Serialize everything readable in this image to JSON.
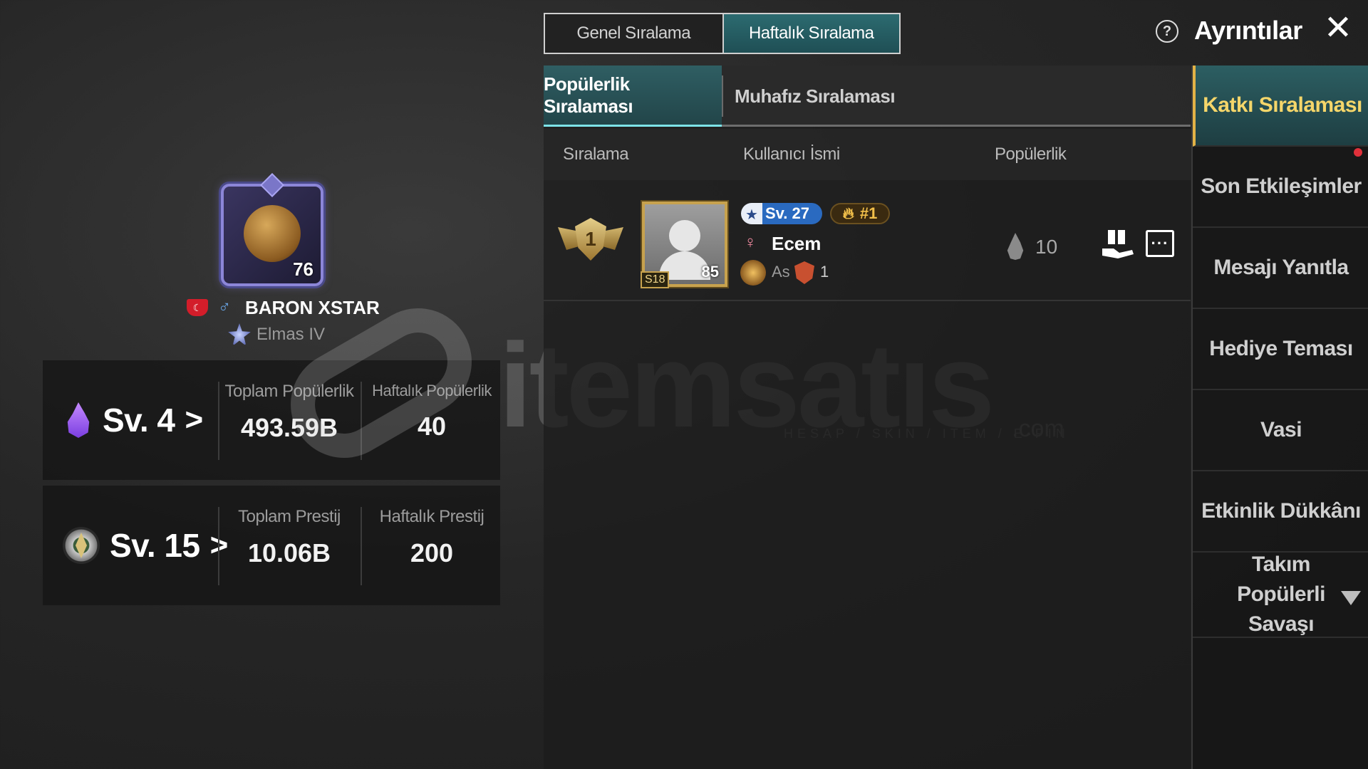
{
  "player": {
    "avatar_level": "76",
    "name": "BARON  XSTAR",
    "tier": "Elmas IV",
    "flag_icon": "turkey-flag-icon",
    "gender_icon": "male-icon"
  },
  "stats": {
    "popularity": {
      "level": "Sv. 4",
      "total_label": "Toplam Popülerlik",
      "total_value": "493.59B",
      "weekly_label": "Haftalık Popülerlik",
      "weekly_value": "40"
    },
    "prestige": {
      "level": "Sv. 15",
      "total_label": "Toplam Prestij",
      "total_value": "10.06B",
      "weekly_label": "Haftalık Prestij",
      "weekly_value": "200"
    }
  },
  "watermark": {
    "text": "itemsatıs",
    "sub": "HESAP / SKIN / ITEM / E-PIN",
    "com": ".com"
  },
  "top_tabs": {
    "general": "Genel Sıralama",
    "weekly": "Haftalık Sıralama"
  },
  "header": {
    "help": "?",
    "details": "Ayrıntılar",
    "close": "✕"
  },
  "sub_tabs": {
    "popularity": "Popülerlik Sıralaması",
    "guardian": "Muhafız Sıralaması"
  },
  "table": {
    "headers": [
      "Sıralama",
      "Kullanıcı İsmi",
      "Popülerlik"
    ],
    "rows": [
      {
        "rank": "1",
        "avatar_level": "85",
        "season": "S18",
        "level": "Sv. 27",
        "rank_tag": "#1",
        "gender_icon": "female-icon",
        "name": "Ecem",
        "tier": "As",
        "badge_count": "1",
        "popularity": "10"
      }
    ]
  },
  "sidebar": {
    "items": [
      {
        "label": "Katkı Sıralaması"
      },
      {
        "label": "Son Etkileşimler"
      },
      {
        "label": "Mesajı Yanıtla"
      },
      {
        "label": "Hediye Teması"
      },
      {
        "label": "Vasi"
      },
      {
        "label": "Etkinlik Dükkânı"
      },
      {
        "label": "Takım Popülerli Savaşı"
      }
    ]
  },
  "colors": {
    "accent_teal": "#2c6b70",
    "active_gold": "#f5d66a",
    "notification": "#e0303a"
  }
}
